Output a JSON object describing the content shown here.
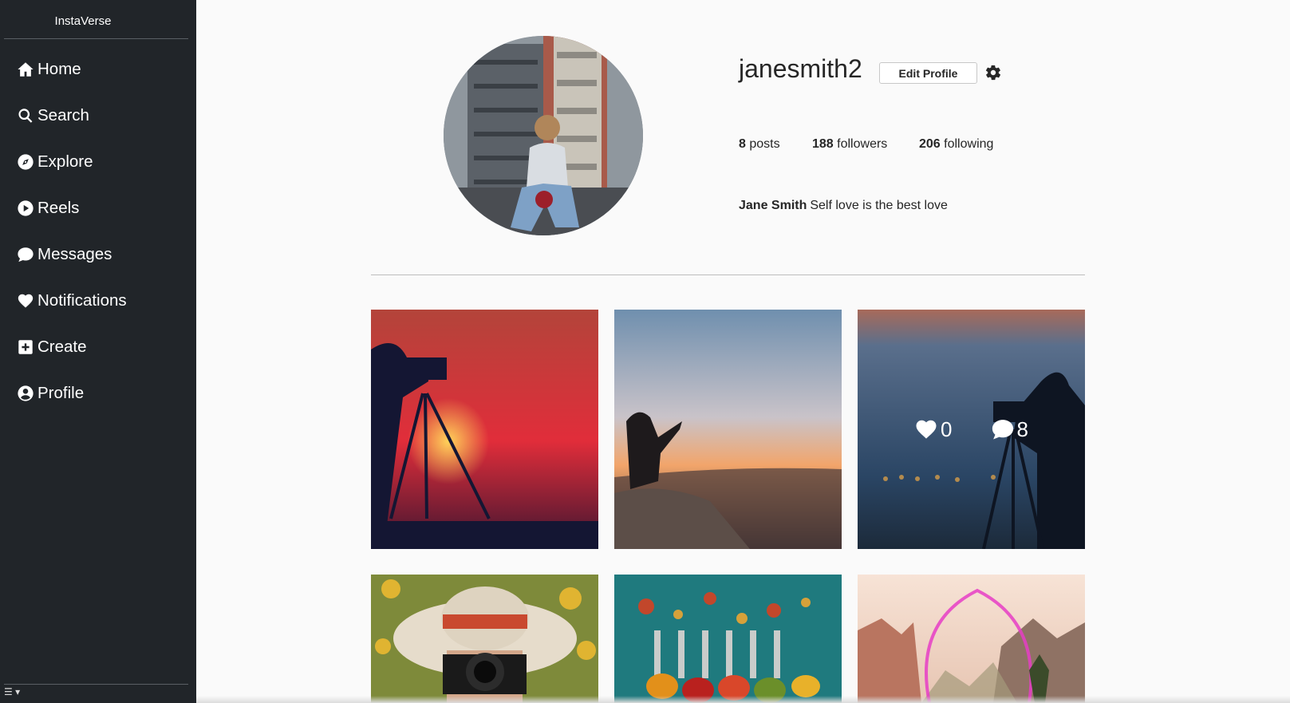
{
  "app": {
    "brand": "InstaVerse"
  },
  "sidebar": {
    "items": [
      {
        "label": "Home",
        "icon": "house-icon"
      },
      {
        "label": "Search",
        "icon": "magnifier-icon"
      },
      {
        "label": "Explore",
        "icon": "compass-icon"
      },
      {
        "label": "Reels",
        "icon": "play-circle-icon"
      },
      {
        "label": "Messages",
        "icon": "chat-bubble-icon"
      },
      {
        "label": "Notifications",
        "icon": "heart-icon"
      },
      {
        "label": "Create",
        "icon": "plus-square-icon"
      },
      {
        "label": "Profile",
        "icon": "user-circle-icon"
      }
    ],
    "more_toggle": "☰ ▾"
  },
  "profile": {
    "username": "janesmith2",
    "edit_button": "Edit Profile",
    "stats": {
      "posts_count": "8",
      "posts_label": "posts",
      "followers_count": "188",
      "followers_label": "followers",
      "following_count": "206",
      "following_label": "following"
    },
    "full_name": "Jane Smith",
    "bio": "Self love is the best love"
  },
  "posts": {
    "hover_post": {
      "likes": "0",
      "comments": "8"
    }
  },
  "colors": {
    "sidebar_bg": "#212529",
    "page_bg": "#fafafa"
  }
}
